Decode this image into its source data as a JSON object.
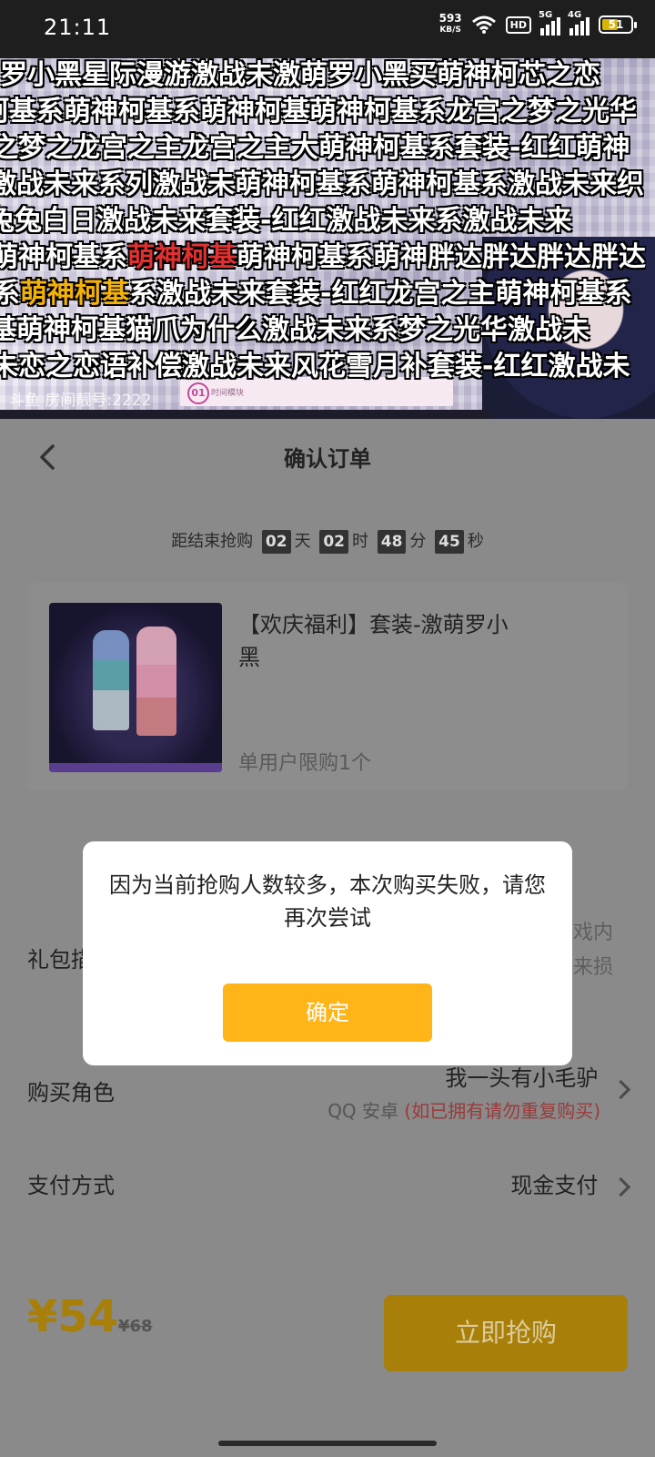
{
  "status_bar": {
    "time": "21:11",
    "net_speed_value": "593",
    "net_speed_unit": "KB/S",
    "hd_label": "HD",
    "sig1_label": "5G",
    "sig2_label": "4G",
    "battery": "51"
  },
  "video": {
    "danmaku": [
      "罗小黑星际漫游激战未激萌罗小黑买萌神柯芯之恋",
      "柯基系萌神柯基系萌神柯基萌神柯基系龙宫之梦之光华",
      "之梦之龙宫之主龙宫之主大萌神柯基系套装-红红萌神",
      "激战未来系列激战未萌神柯基系萌神柯基系激战未来织",
      "兔兔白日激战未来套装-红红激战未来系激战未来",
      "萌神柯基系萌神柯基萌神柯基系萌神胖达胖达胖达胖达",
      "系萌神柯基系激战未来套装-红红龙宫之主萌神柯基系",
      "基萌神柯基猫爪为什么激战未来系梦之光华激战未",
      "未恋之恋语补偿激战未来风花雪月补套装-红红激战未"
    ],
    "highlight_red": "萌神柯基",
    "highlight_yellow": "萌神柯基",
    "room_label": "斗鱼 房间靓号:2222",
    "pink_box_num": "01",
    "pink_box_text": "时间模块"
  },
  "header": {
    "title": "确认订单"
  },
  "countdown": {
    "prefix": "距结束抢购",
    "days": "02",
    "days_unit": "天",
    "hours": "02",
    "hours_unit": "时",
    "minutes": "48",
    "minutes_unit": "分",
    "seconds": "45",
    "seconds_unit": "秒"
  },
  "product": {
    "name": "【欢庆福利】套装-激萌罗小黑",
    "limit": "单用户限购1个"
  },
  "gift": {
    "label": "礼包描述",
    "desc_line1": "戏内",
    "desc_line2": "来损"
  },
  "role": {
    "label": "购买角色",
    "name": "我一头有小毛驴",
    "platform": "QQ 安卓",
    "warning": "(如已拥有请勿重复购买)"
  },
  "payment": {
    "label": "支付方式",
    "value": "现金支付"
  },
  "bottom": {
    "price": "¥54",
    "original_price": "¥68",
    "buy_label": "立即抢购"
  },
  "modal": {
    "message": "因为当前抢购人数较多，本次购买失败，请您再次尝试",
    "confirm_label": "确定"
  },
  "colors": {
    "accent": "#ffb518",
    "dimmed_accent": "#a87f08",
    "overlay_bg": "#8a8a8a"
  }
}
